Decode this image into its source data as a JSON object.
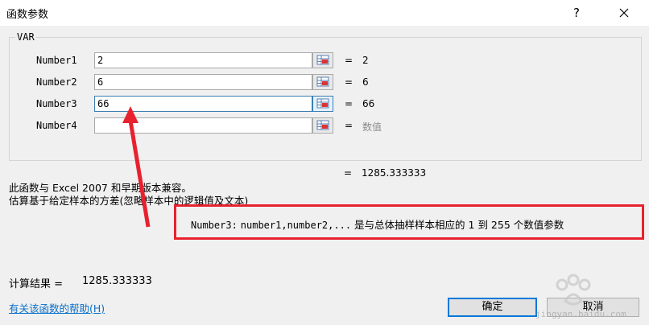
{
  "window": {
    "title": "函数参数",
    "help_label": "?"
  },
  "function_name": "VAR",
  "arguments": [
    {
      "label": "Number1",
      "value": "2",
      "result_eq": "=",
      "result": "2"
    },
    {
      "label": "Number2",
      "value": "6",
      "result_eq": "=",
      "result": "6"
    },
    {
      "label": "Number3",
      "value": "66",
      "result_eq": "=",
      "result": "66"
    },
    {
      "label": "Number4",
      "value": "",
      "result_eq": "=",
      "result": "数值"
    }
  ],
  "total": {
    "eq": "=",
    "value": "1285.333333"
  },
  "description": {
    "compat": "此函数与 Excel 2007 和早期版本兼容。",
    "summary": "估算基于给定样本的方差(忽略样本中的逻辑值及文本)"
  },
  "hint": {
    "arg": "Number3:",
    "params": "number1,number2,...",
    "text": "是与总体抽样样本相应的 1 到 255 个数值参数"
  },
  "calc": {
    "label": "计算结果 =",
    "value": "1285.333333"
  },
  "help_link": "有关该函数的帮助(H)",
  "buttons": {
    "ok": "确定",
    "cancel": "取消"
  },
  "watermark": {
    "text": "jingyan.baidu.com"
  },
  "colors": {
    "annotation_red": "#e8212f",
    "link": "#0b6fc9",
    "focus": "#3c7fb1"
  },
  "icons": {
    "range_picker": "range-picker-icon",
    "close": "close-icon"
  }
}
